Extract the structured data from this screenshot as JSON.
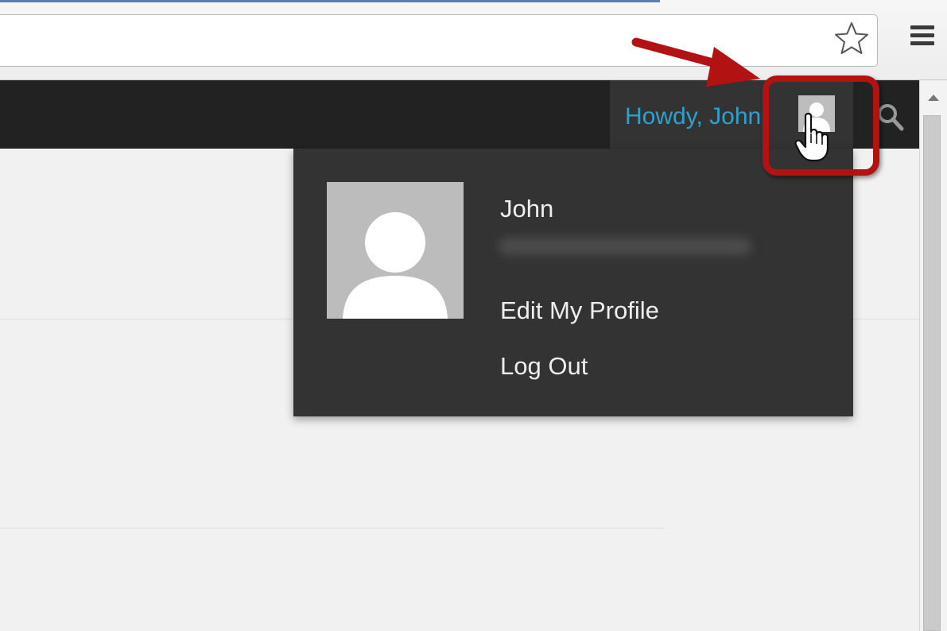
{
  "admin_bar": {
    "greeting": "Howdy, John"
  },
  "account_menu": {
    "display_name": "John",
    "items": [
      {
        "label": "Edit My Profile"
      },
      {
        "label": "Log Out"
      }
    ]
  },
  "icons": {
    "bookmark": "star-icon",
    "browser_menu": "hamburger-menu-icon",
    "search": "search-icon",
    "avatar": "user-avatar-icon",
    "cursor": "hand-pointer-cursor"
  },
  "colors": {
    "admin_bar_bg": "#222222",
    "menu_bg": "#333333",
    "greeting_link": "#2ea2cc",
    "annotation": "#b31212"
  }
}
